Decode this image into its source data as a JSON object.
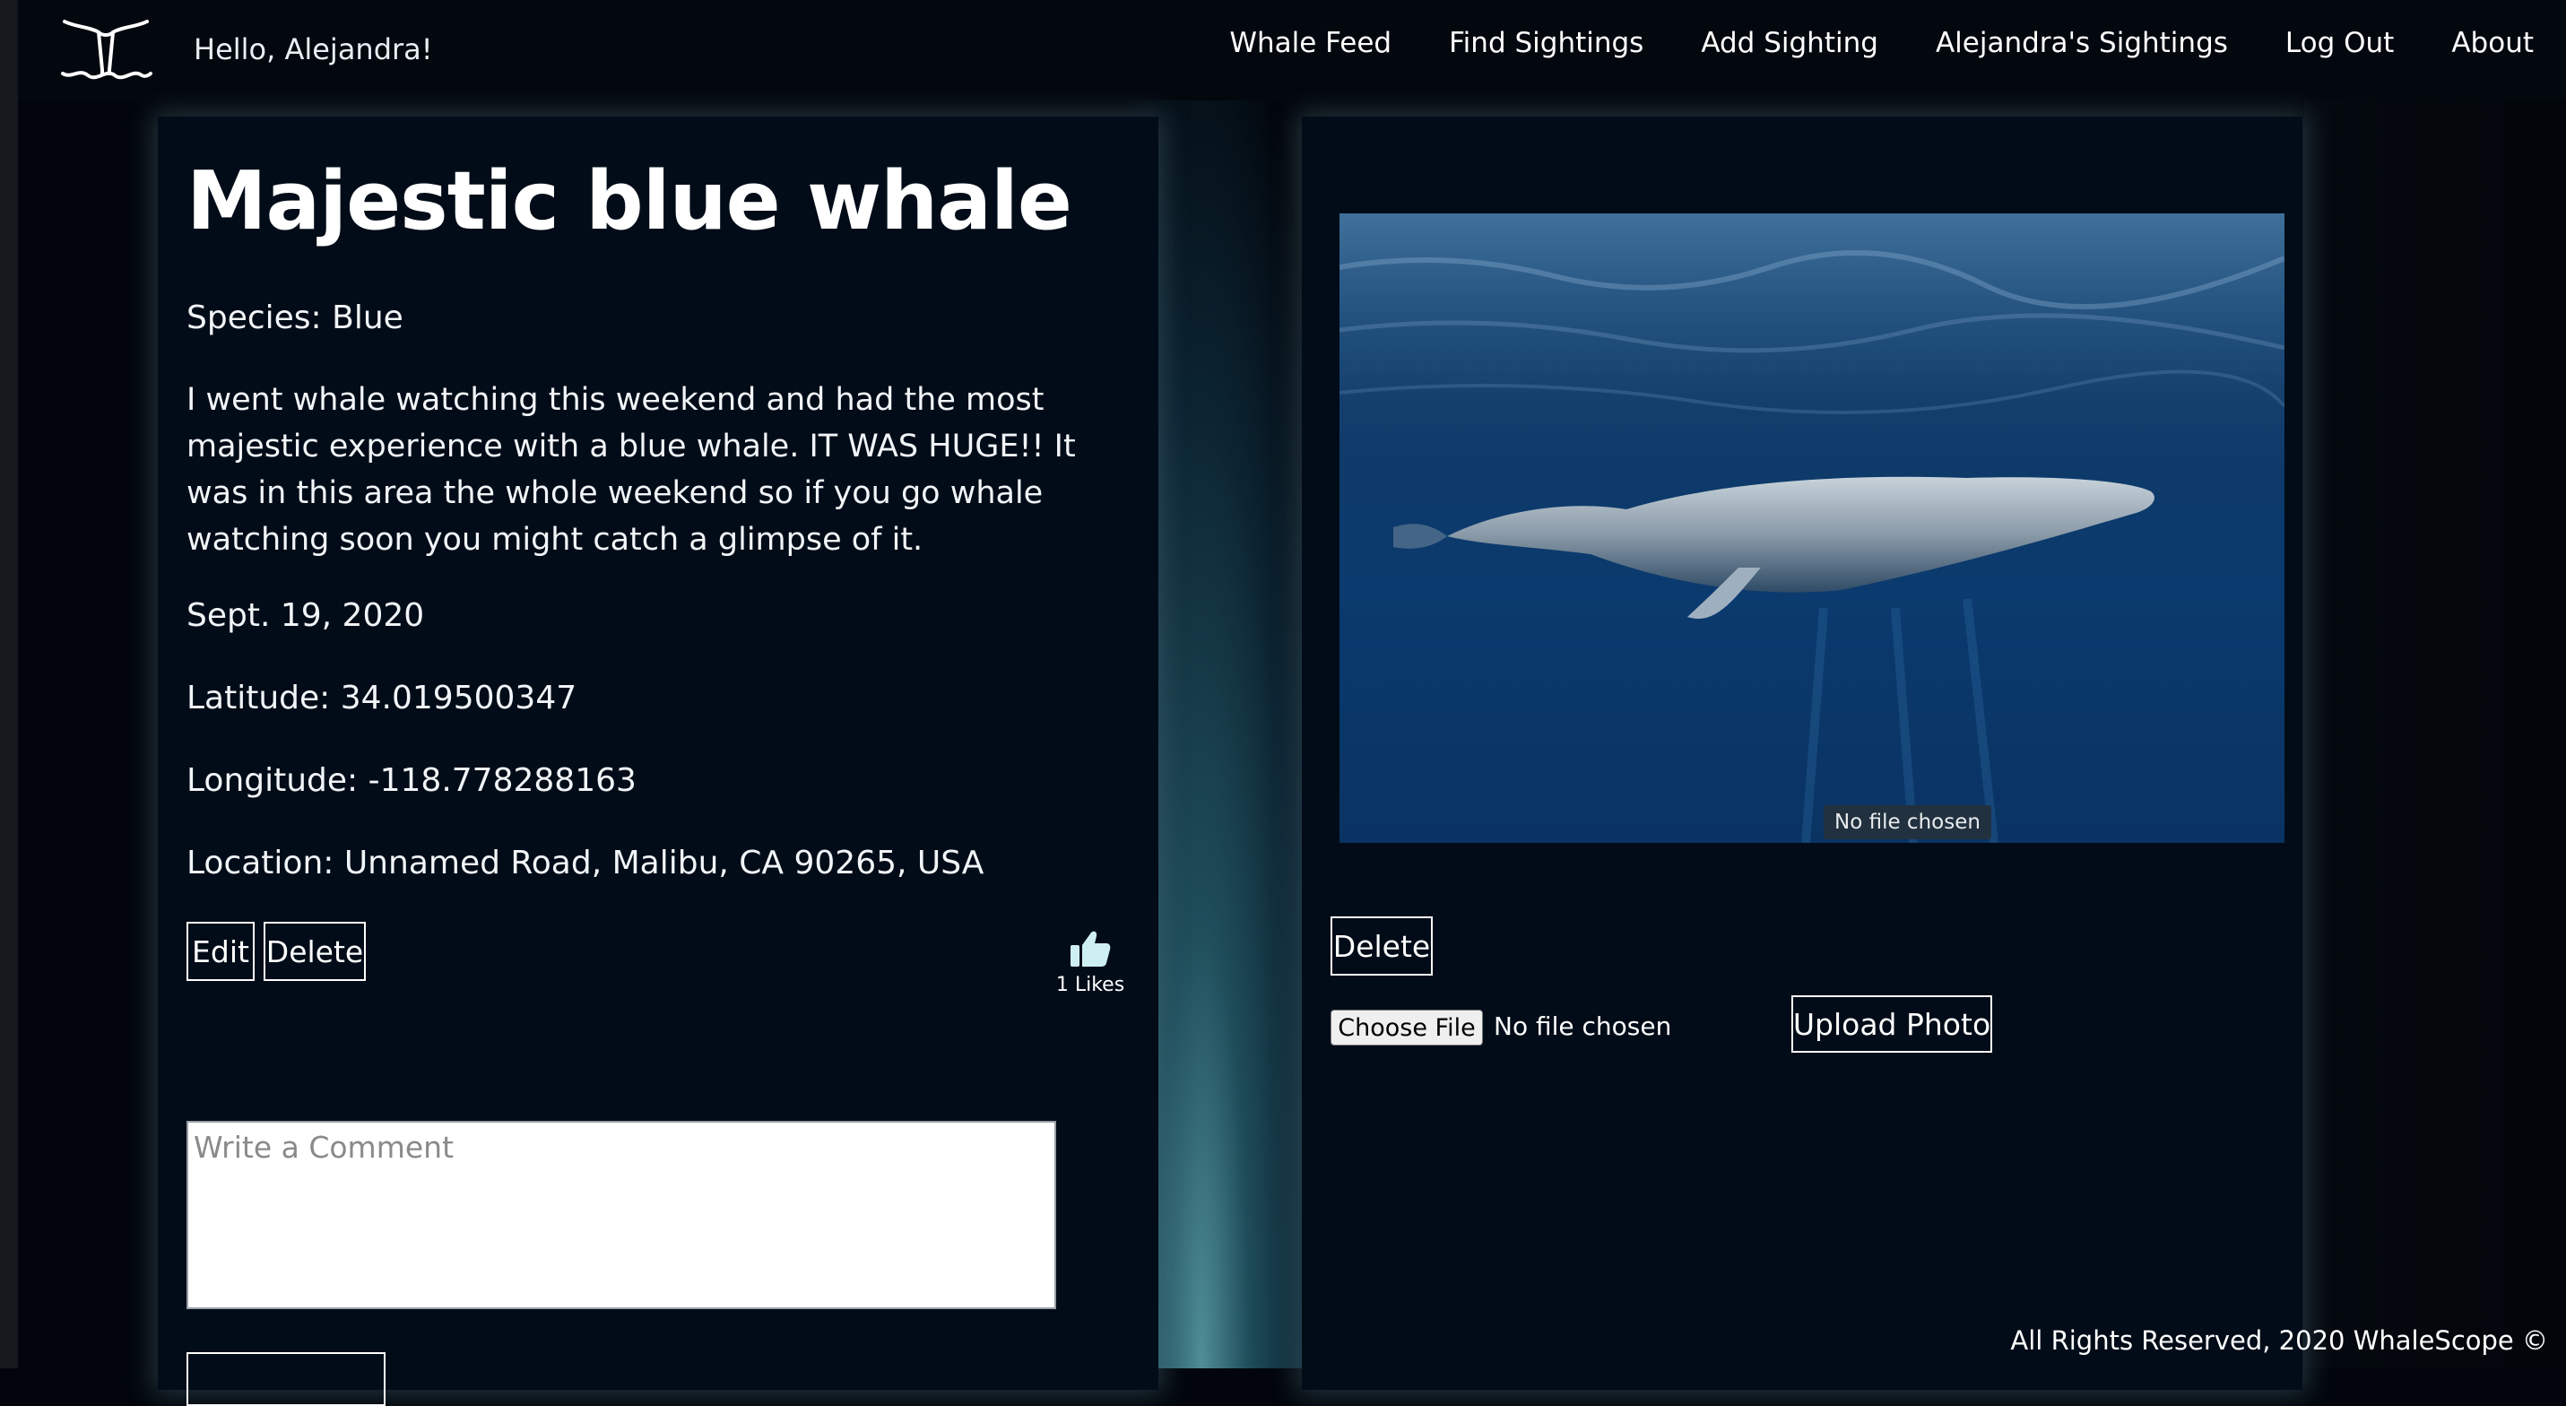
{
  "header": {
    "greeting": "Hello, Alejandra!",
    "nav": [
      {
        "label": "Whale Feed"
      },
      {
        "label": "Find Sightings"
      },
      {
        "label": "Add Sighting"
      },
      {
        "label": "Alejandra's Sightings"
      },
      {
        "label": "Log Out"
      },
      {
        "label": "About"
      }
    ]
  },
  "sighting": {
    "title": "Majestic blue whale",
    "species": "Species: Blue",
    "description": "I went whale watching this weekend and had the most majestic experience with a blue whale. IT WAS HUGE!! It was in this area the whole weekend so if you go whale watching soon you might catch a glimpse of it.",
    "date": "Sept. 19, 2020",
    "latitude": "Latitude: 34.019500347",
    "longitude": "Longitude: -118.778288163",
    "location": "Location: Unnamed Road, Malibu, CA 90265, USA",
    "edit_label": "Edit",
    "delete_label": "Delete",
    "likes_text": "1 Likes",
    "like_icon": "thumbs-up-icon"
  },
  "comment": {
    "placeholder": "Write a Comment"
  },
  "photo_panel": {
    "tooltip": "No file chosen",
    "delete_label": "Delete",
    "choose_file_label": "Choose File",
    "no_file_label": "No file chosen",
    "upload_label": "Upload Photo"
  },
  "footer": {
    "text": "All Rights Reserved, 2020 WhaleScope ©"
  },
  "colors": {
    "background": "#02060c",
    "card": "#020c18",
    "like_icon": "#cdeff2"
  }
}
